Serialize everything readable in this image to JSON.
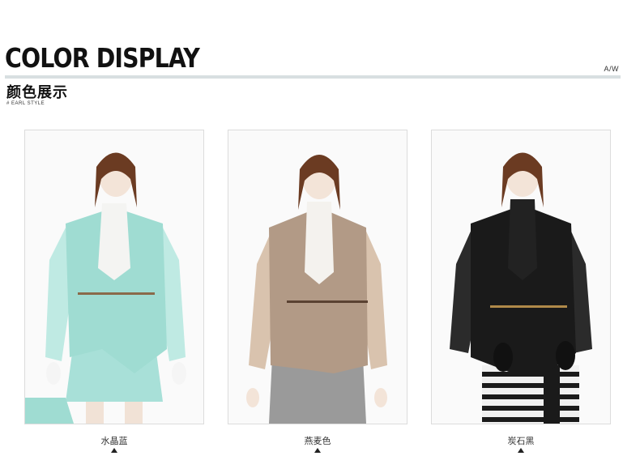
{
  "header": {
    "title": "COLOR DISPLAY",
    "season": "A/W",
    "subtitle": "颜色展示",
    "tagline": "# EARL STYLE"
  },
  "products": [
    {
      "caption": "水晶蓝",
      "coat_color": "#9fdcd2",
      "sleeve_color": "#bfeae3",
      "skirt_color": "#a8e0d8"
    },
    {
      "caption": "燕麦色",
      "coat_color": "#b29a86",
      "sleeve_color": "#d9c3ae",
      "skirt_color": "#9a9a9a"
    },
    {
      "caption": "炭石黑",
      "coat_color": "#1a1a1a",
      "sleeve_color": "#2b2b2b",
      "skirt_color": "#f0f0f0"
    }
  ]
}
